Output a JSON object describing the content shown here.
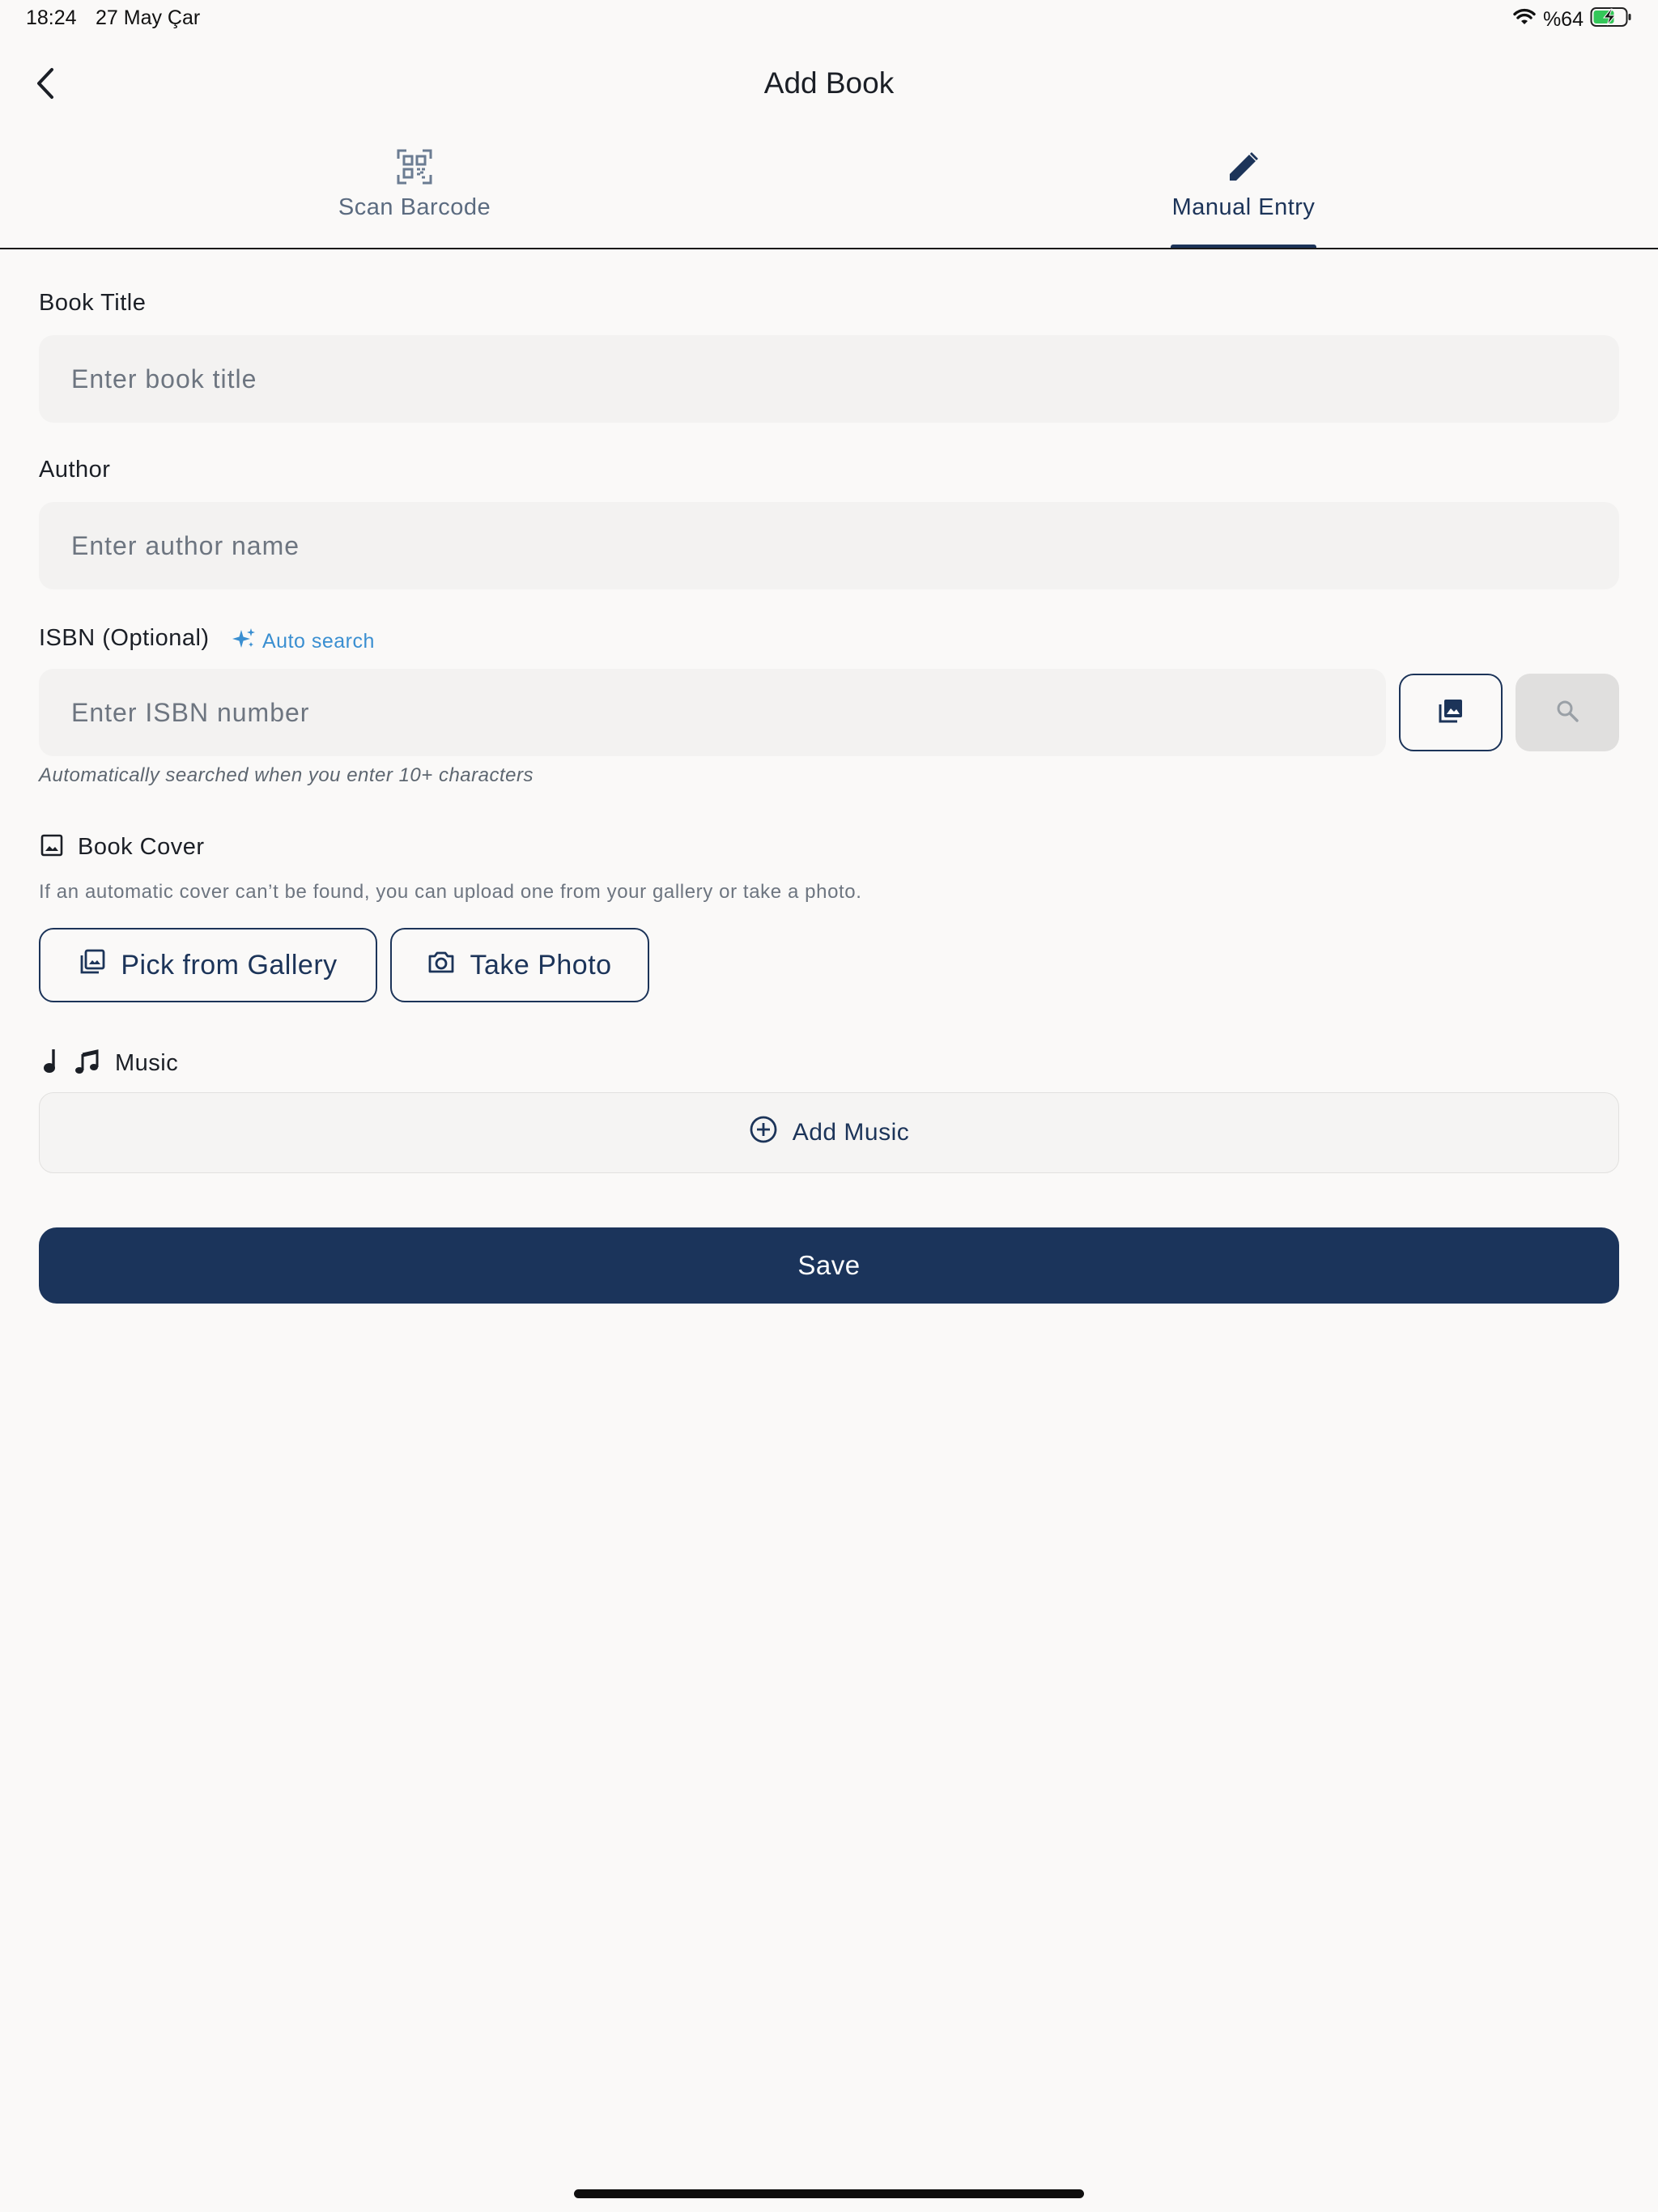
{
  "status_bar": {
    "time": "18:24",
    "date": "27 May Çar",
    "battery": "%64"
  },
  "header": {
    "title": "Add Book"
  },
  "tabs": [
    {
      "label": "Scan Barcode",
      "icon": "qr-scan-icon",
      "active": false
    },
    {
      "label": "Manual Entry",
      "icon": "pencil-icon",
      "active": true
    }
  ],
  "form": {
    "title": {
      "label": "Book Title",
      "placeholder": "Enter book title",
      "value": ""
    },
    "author": {
      "label": "Author",
      "placeholder": "Enter author name",
      "value": ""
    },
    "isbn": {
      "label": "ISBN (Optional)",
      "badge": "Auto search",
      "placeholder": "Enter ISBN number",
      "value": "",
      "hint": "Automatically searched when you enter 10+ characters"
    },
    "cover": {
      "label": "Book Cover",
      "description": "If an automatic cover can’t be found, you can upload one from your gallery or take a photo.",
      "gallery_label": "Pick from Gallery",
      "photo_label": "Take Photo"
    },
    "music": {
      "label": "Music",
      "add_label": "Add Music"
    },
    "save_label": "Save"
  },
  "colors": {
    "background": "#faf9f8",
    "primary": "#1b345b",
    "accent": "#3a8fd1",
    "input_bg": "#f3f2f1"
  }
}
